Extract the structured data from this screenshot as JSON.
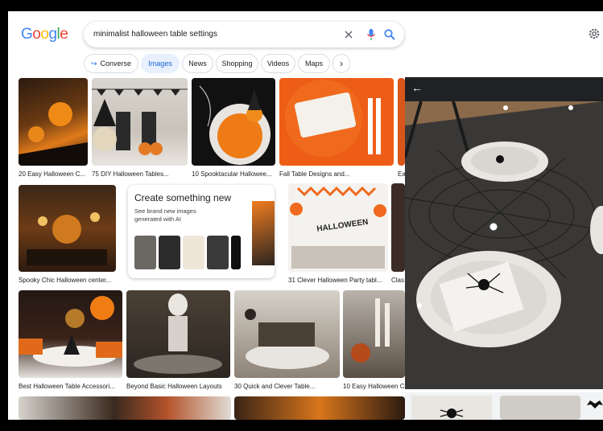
{
  "header": {
    "logo_text": "Google",
    "search_query": "minimalist halloween table settings"
  },
  "chips": [
    {
      "label": "Converse",
      "selected": false
    },
    {
      "label": "Images",
      "selected": true
    },
    {
      "label": "News",
      "selected": false
    },
    {
      "label": "Shopping",
      "selected": false
    },
    {
      "label": "Videos",
      "selected": false
    },
    {
      "label": "Maps",
      "selected": false
    }
  ],
  "results": [
    {
      "caption": "20 Easy Halloween C..."
    },
    {
      "caption": "75 DIY Halloween Tables..."
    },
    {
      "caption": "10 Spooktacular Hallowee..."
    },
    {
      "caption": "Fall Table Designs and..."
    },
    {
      "caption": "Ea"
    },
    {
      "caption": "Spooky Chic Halloween center..."
    },
    {
      "caption": "31 Clever Halloween Party tabl..."
    },
    {
      "caption": "Clas"
    },
    {
      "caption": "Best Halloween Table Accessori..."
    },
    {
      "caption": "Beyond Basic Halloween Layouts"
    },
    {
      "caption": "30 Quick and Clever Table..."
    },
    {
      "caption": "10 Easy Halloween C"
    }
  ],
  "ai_card": {
    "title": "Create something new",
    "subtitle": "See brand new images generated with AI"
  },
  "party_banner_text": "HALLOWEEN",
  "colors": {
    "google_blue": "#4285F4",
    "google_red": "#EA4335",
    "google_yellow": "#FBBC05",
    "google_green": "#34A853",
    "chip_selected_bg": "#e8f0fe",
    "chip_selected_text": "#1967d2"
  }
}
